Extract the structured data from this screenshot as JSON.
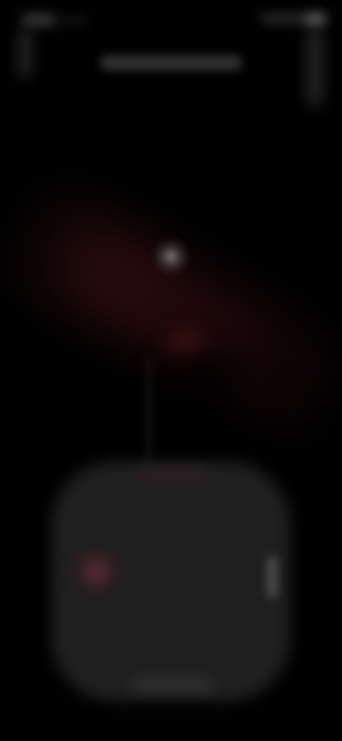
{
  "colors": {
    "background": "#000000",
    "sheet": "#1f1f1f",
    "accent_red": "#6e323c",
    "glow": "#aaaaaa"
  },
  "icons": {
    "back": "back-arrow-icon",
    "menu": "more-options-icon",
    "record": "record-dot-icon"
  }
}
